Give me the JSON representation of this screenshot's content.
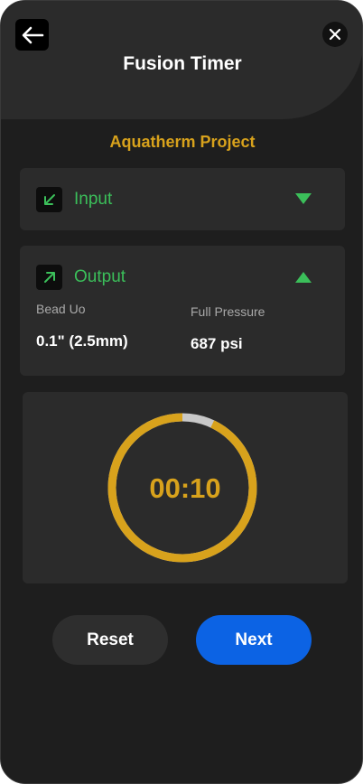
{
  "header": {
    "title": "Fusion Timer",
    "back_icon": "arrow-left-icon",
    "close_icon": "close-icon"
  },
  "project_name": "Aquatherm Project",
  "sections": {
    "input": {
      "label": "Input",
      "icon": "arrow-down-left-icon",
      "expanded": false
    },
    "output": {
      "label": "Output",
      "icon": "arrow-up-right-icon",
      "expanded": true,
      "fields": [
        {
          "label": "Bead Uo",
          "value": "0.1\" (2.5mm)"
        },
        {
          "label": "Full Pressure",
          "value": "687 psi"
        }
      ]
    }
  },
  "timer": {
    "display": "00:10",
    "progress_fraction": 0.93
  },
  "buttons": {
    "reset_label": "Reset",
    "next_label": "Next"
  },
  "colors": {
    "accent_gold": "#d8a21c",
    "section_green": "#3bbf5a",
    "primary_blue": "#0c63e4",
    "ring_track": "#c8c8c8"
  }
}
